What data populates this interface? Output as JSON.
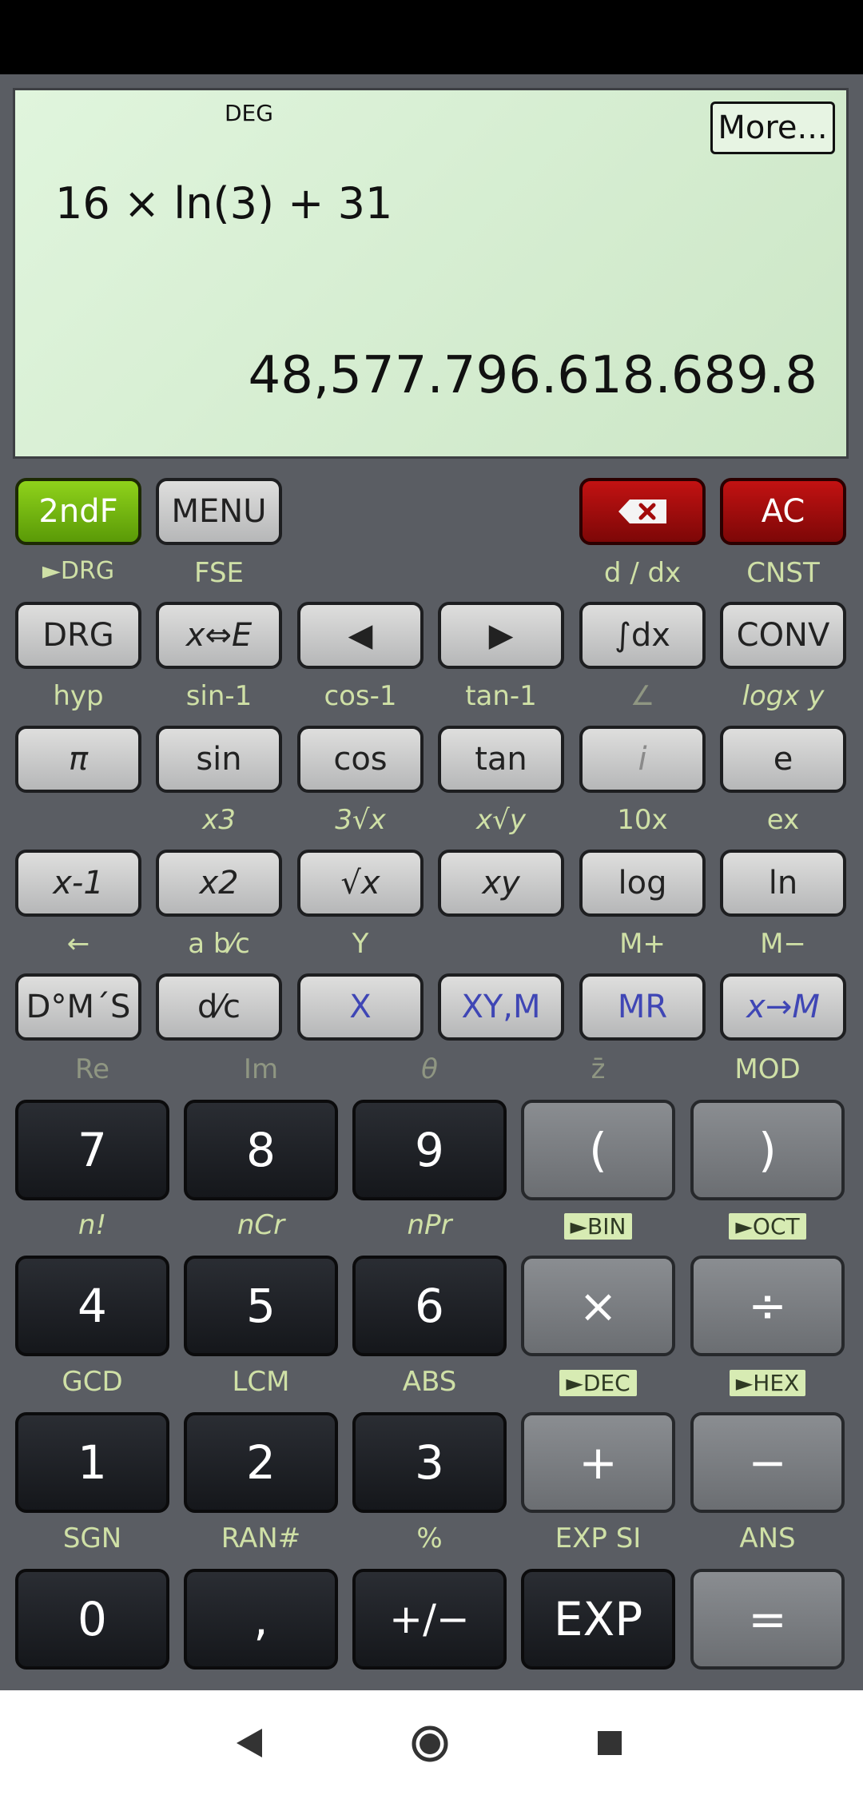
{
  "display": {
    "angle_mode": "DEG",
    "more_label": "More...",
    "expression": "16 × ln(3) + 31",
    "result": "48,577.796.618.689.8"
  },
  "top_row": {
    "second_f": "2ndF",
    "menu": "MENU",
    "backspace_icon": "backspace-icon",
    "ac": "AC"
  },
  "row1": {
    "labels": [
      "►DRG",
      "FSE",
      "",
      "",
      "d / dx",
      "CNST"
    ],
    "keys": [
      "DRG",
      "x⇔E",
      "◀",
      "▶",
      "∫dx",
      "CONV"
    ]
  },
  "row2": {
    "labels": [
      "hyp",
      "sin-1",
      "cos-1",
      "tan-1",
      "∠",
      "logx y"
    ],
    "keys": [
      "π",
      "sin",
      "cos",
      "tan",
      "i",
      "e"
    ]
  },
  "row3": {
    "labels": [
      "",
      "x3",
      "3√x",
      "x√y",
      "10x",
      "ex"
    ],
    "keys": [
      "x-1",
      "x2",
      "√x",
      "xy",
      "log",
      "ln"
    ]
  },
  "row4": {
    "labels": [
      "←",
      "a b⁄c",
      "Y",
      "",
      "M+",
      "M−"
    ],
    "keys": [
      "D°M´S",
      "d⁄c",
      "X",
      "XY,M",
      "MR",
      "x→M"
    ]
  },
  "row5": {
    "labels": [
      "Re",
      "Im",
      "θ",
      "z̄",
      "MOD"
    ],
    "keys": [
      "7",
      "8",
      "9",
      "(",
      ")"
    ]
  },
  "row6": {
    "labels": [
      "n!",
      "nCr",
      "nPr",
      "►BIN",
      "►OCT"
    ],
    "keys": [
      "4",
      "5",
      "6",
      "×",
      "÷"
    ]
  },
  "row7": {
    "labels": [
      "GCD",
      "LCM",
      "ABS",
      "►DEC",
      "►HEX"
    ],
    "keys": [
      "1",
      "2",
      "3",
      "+",
      "−"
    ]
  },
  "row8": {
    "labels": [
      "SGN",
      "RAN#",
      "%",
      "EXP SI",
      "ANS"
    ],
    "keys": [
      "0",
      ",",
      "+/−",
      "EXP",
      "="
    ]
  },
  "nav": {
    "back": "nav-back-icon",
    "home": "nav-home-icon",
    "recents": "nav-recents-icon"
  }
}
